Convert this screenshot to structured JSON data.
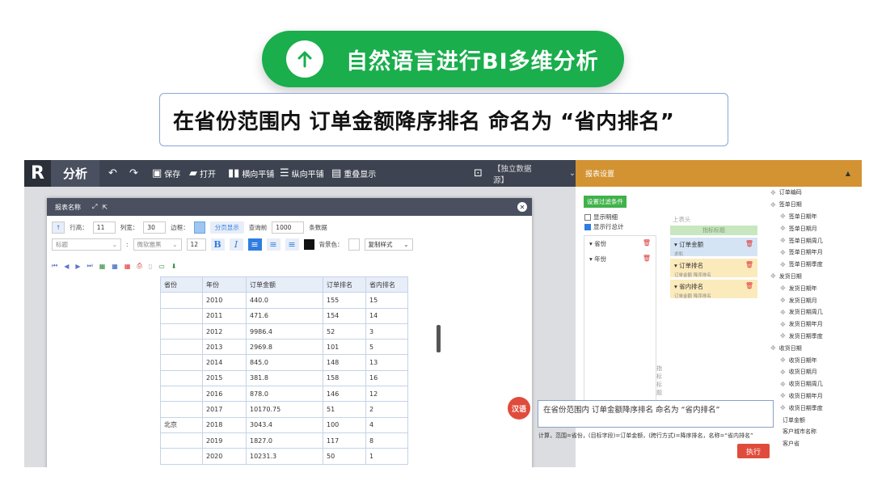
{
  "hero": {
    "title": "自然语言进行BI多维分析"
  },
  "prompt": {
    "text": "在省份范围内 订单金额降序排名 命名为 “省内排名”"
  },
  "topbar": {
    "logo": "R",
    "title": "分析",
    "save": "保存",
    "open": "打开",
    "hflat": "横向平铺",
    "vflat": "纵向平铺",
    "overlay": "重叠显示",
    "datasource": "【独立数据源】"
  },
  "settings": {
    "title": "报表设置"
  },
  "dialog": {
    "title": "报表名称",
    "row_height_label": "行高：",
    "row_height": "11",
    "col_width_label": "列宽：",
    "col_width": "30",
    "border_label": "边框：",
    "paging": "分页显示",
    "query_label": "查询前",
    "query_count": "1000",
    "query_suffix": "条数据",
    "style_select": "标题",
    "font_select": "微软雅黑",
    "font_size": "12",
    "bg_label": "背景色：",
    "copy_style": "复制样式"
  },
  "table": {
    "headers": [
      "省份",
      "年份",
      "订单金额",
      "订单排名",
      "省内排名"
    ],
    "province": "北京",
    "rows": [
      [
        "2010",
        "440.0",
        "155",
        "15"
      ],
      [
        "2011",
        "471.6",
        "154",
        "14"
      ],
      [
        "2012",
        "9986.4",
        "52",
        "3"
      ],
      [
        "2013",
        "2969.8",
        "101",
        "5"
      ],
      [
        "2014",
        "845.0",
        "148",
        "13"
      ],
      [
        "2015",
        "381.8",
        "158",
        "16"
      ],
      [
        "2016",
        "878.0",
        "146",
        "12"
      ],
      [
        "2017",
        "10170.75",
        "51",
        "2"
      ],
      [
        "2018",
        "3043.4",
        "100",
        "4"
      ],
      [
        "2019",
        "1827.0",
        "117",
        "8"
      ],
      [
        "2020",
        "10231.3",
        "50",
        "1"
      ]
    ]
  },
  "panel": {
    "filter_btn": "设置过滤条件",
    "show_detail": "显示明细",
    "show_total": "显示行总计",
    "dims": [
      "省份",
      "年份"
    ],
    "col_head": "上表头",
    "metric_title": "指标标题",
    "metrics": [
      {
        "name": "订单金额",
        "sub": "求和"
      },
      {
        "name": "订单排名",
        "sub": "订单金额 降序排名"
      },
      {
        "name": "省内排名",
        "sub": "订单金额 降序排名"
      }
    ],
    "indicator": "指标标题"
  },
  "fields": [
    {
      "label": "订单编码",
      "level": "top"
    },
    {
      "label": "签单日期",
      "level": "top"
    },
    {
      "label": "签单日期年",
      "level": "sub"
    },
    {
      "label": "签单日期月",
      "level": "sub"
    },
    {
      "label": "签单日期周几",
      "level": "sub"
    },
    {
      "label": "签单日期年月",
      "level": "sub"
    },
    {
      "label": "签单日期季度",
      "level": "sub"
    },
    {
      "label": "发货日期",
      "level": "top"
    },
    {
      "label": "发货日期年",
      "level": "sub"
    },
    {
      "label": "发货日期月",
      "level": "sub"
    },
    {
      "label": "发货日期周几",
      "level": "sub"
    },
    {
      "label": "发货日期年月",
      "level": "sub"
    },
    {
      "label": "发货日期季度",
      "level": "sub"
    },
    {
      "label": "收货日期",
      "level": "top"
    },
    {
      "label": "收货日期年",
      "level": "sub"
    },
    {
      "label": "收货日期月",
      "level": "sub"
    },
    {
      "label": "收货日期周几",
      "level": "sub"
    },
    {
      "label": "收货日期年月",
      "level": "sub"
    },
    {
      "label": "收货日期季度",
      "level": "sub"
    },
    {
      "label": "订单金额",
      "level": "plain"
    },
    {
      "label": "客户城市名称",
      "level": "plain"
    },
    {
      "label": "客户省",
      "level": "plain"
    }
  ],
  "nl": {
    "badge": "汉语",
    "input": "在省份范围内 订单金额降序排名 命名为 “省内排名”",
    "result": "计算，范围=省份，(目标字段)=订单金额，(跨行方式)=降序排名，名称=“省内排名”",
    "exec": "执行"
  }
}
